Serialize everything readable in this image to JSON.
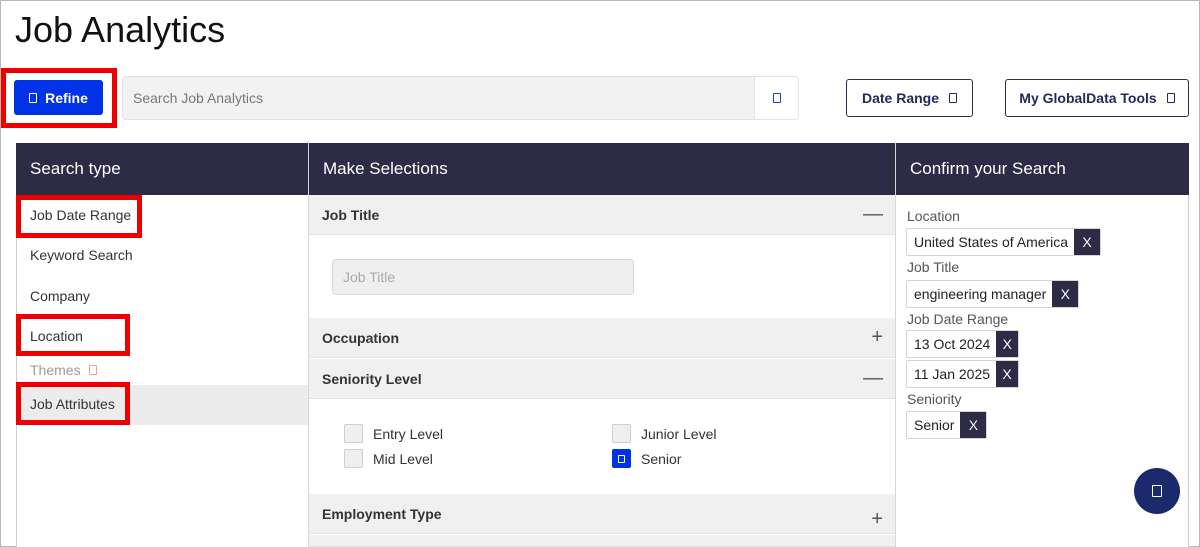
{
  "page": {
    "title": "Job Analytics"
  },
  "toolbar": {
    "refine_label": "Refine",
    "search_placeholder": "Search Job Analytics",
    "date_range_label": "Date Range",
    "tools_label": "My GlobalData Tools"
  },
  "columns": {
    "search_type": "Search type",
    "make_selections": "Make Selections",
    "confirm": "Confirm your Search"
  },
  "search_types": [
    {
      "label": "Job Date Range",
      "highlighted": true
    },
    {
      "label": "Keyword Search"
    },
    {
      "label": "Company"
    },
    {
      "label": "Location",
      "highlighted": true
    },
    {
      "label": "Themes",
      "disabled": true
    },
    {
      "label": "Job Attributes",
      "highlighted": true,
      "active": true
    }
  ],
  "selections": {
    "job_title": {
      "label": "Job Title",
      "toggle": "—",
      "placeholder": "Job Title"
    },
    "occupation": {
      "label": "Occupation",
      "toggle": "+"
    },
    "seniority": {
      "label": "Seniority Level",
      "toggle": "—"
    },
    "employment_type": {
      "label": "Employment Type",
      "toggle": "+"
    },
    "seniority_options": [
      {
        "label": "Entry Level",
        "checked": false
      },
      {
        "label": "Junior Level",
        "checked": false
      },
      {
        "label": "Mid Level",
        "checked": false
      },
      {
        "label": "Senior",
        "checked": true
      }
    ]
  },
  "confirm": {
    "location_label": "Location",
    "location_value": "United States of America",
    "job_title_label": "Job Title",
    "job_title_value": "engineering manager",
    "date_range_label": "Job Date Range",
    "date_from": "13 Oct 2024",
    "date_to": "11 Jan 2025",
    "seniority_label": "Seniority",
    "seniority_value": "Senior",
    "remove_glyph": "X"
  },
  "colors": {
    "primary_button": "#0033e6",
    "header_bar": "#2d2b45",
    "highlight": "#ee0000",
    "fab": "#1a2a6c"
  },
  "icons": {
    "refine": "filter-icon",
    "search": "search-icon",
    "date_range": "calendar-icon",
    "tools": "chevron-down-icon",
    "themes": "lock-icon",
    "chat": "chat-icon"
  }
}
